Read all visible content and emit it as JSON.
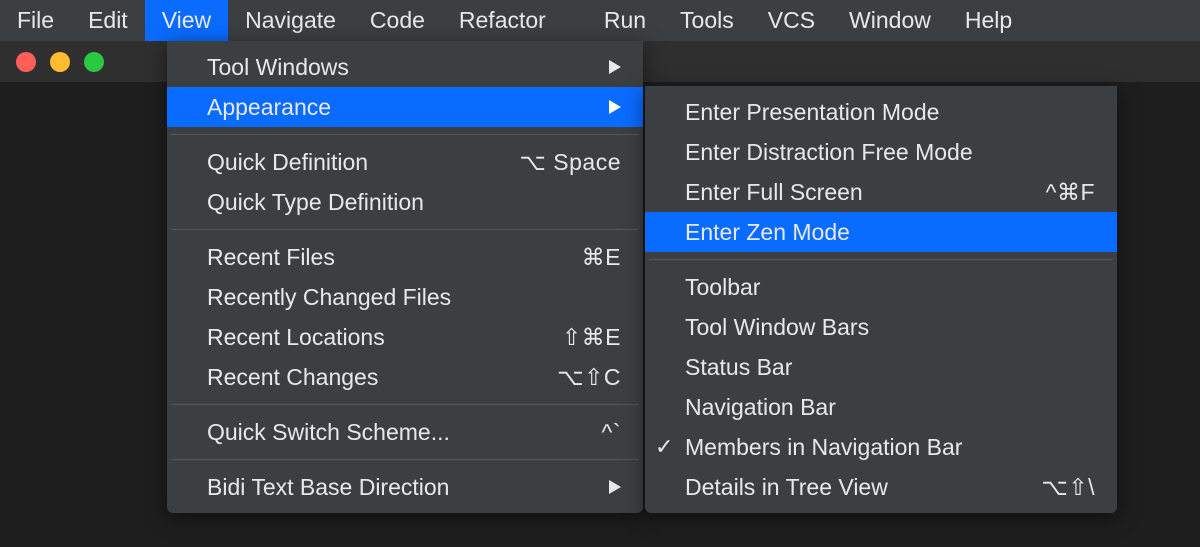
{
  "menubar": {
    "items": [
      "File",
      "Edit",
      "View",
      "Navigate",
      "Code",
      "Refactor",
      "Run",
      "Tools",
      "VCS",
      "Window",
      "Help"
    ],
    "active_index": 2
  },
  "view_menu": {
    "groups": [
      [
        {
          "label": "Tool Windows",
          "shortcut": "",
          "submenu": true,
          "selected": false
        },
        {
          "label": "Appearance",
          "shortcut": "",
          "submenu": true,
          "selected": true
        }
      ],
      [
        {
          "label": "Quick Definition",
          "shortcut": "⌥ Space",
          "submenu": false,
          "selected": false
        },
        {
          "label": "Quick Type Definition",
          "shortcut": "",
          "submenu": false,
          "selected": false
        }
      ],
      [
        {
          "label": "Recent Files",
          "shortcut": "⌘E",
          "submenu": false,
          "selected": false
        },
        {
          "label": "Recently Changed Files",
          "shortcut": "",
          "submenu": false,
          "selected": false
        },
        {
          "label": "Recent Locations",
          "shortcut": "⇧⌘E",
          "submenu": false,
          "selected": false
        },
        {
          "label": "Recent Changes",
          "shortcut": "⌥⇧C",
          "submenu": false,
          "selected": false
        }
      ],
      [
        {
          "label": "Quick Switch Scheme...",
          "shortcut": "^`",
          "submenu": false,
          "selected": false
        }
      ],
      [
        {
          "label": "Bidi Text Base Direction",
          "shortcut": "",
          "submenu": true,
          "selected": false
        }
      ]
    ]
  },
  "appearance_menu": {
    "groups": [
      [
        {
          "label": "Enter Presentation Mode",
          "shortcut": "",
          "checked": false,
          "selected": false
        },
        {
          "label": "Enter Distraction Free Mode",
          "shortcut": "",
          "checked": false,
          "selected": false
        },
        {
          "label": "Enter Full Screen",
          "shortcut": "^⌘F",
          "checked": false,
          "selected": false
        },
        {
          "label": "Enter Zen Mode",
          "shortcut": "",
          "checked": false,
          "selected": true
        }
      ],
      [
        {
          "label": "Toolbar",
          "shortcut": "",
          "checked": false,
          "selected": false
        },
        {
          "label": "Tool Window Bars",
          "shortcut": "",
          "checked": false,
          "selected": false
        },
        {
          "label": "Status Bar",
          "shortcut": "",
          "checked": false,
          "selected": false
        },
        {
          "label": "Navigation Bar",
          "shortcut": "",
          "checked": false,
          "selected": false
        },
        {
          "label": "Members in Navigation Bar",
          "shortcut": "",
          "checked": true,
          "selected": false
        },
        {
          "label": "Details in Tree View",
          "shortcut": "⌥⇧\\",
          "checked": false,
          "selected": false
        }
      ]
    ]
  }
}
